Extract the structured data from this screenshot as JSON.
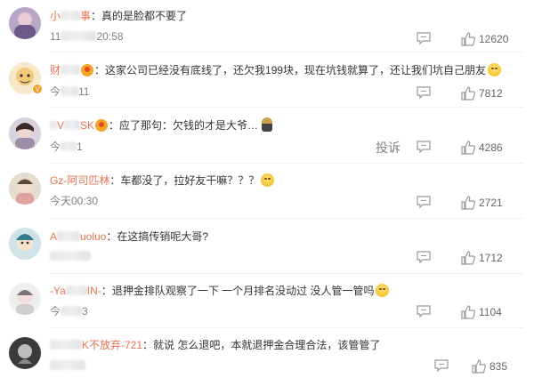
{
  "comments": [
    {
      "username_visible": "小",
      "username_tail": "事",
      "text": "真的是脸都不要了",
      "time_prefix": "11",
      "time_suffix": "20:58",
      "likes": "12620"
    },
    {
      "username_visible": "财",
      "username_tail": "",
      "text": "这家公司已经没有底线了，还欠我199块，现在坑钱就算了，还让我们坑自己朋友",
      "time_prefix": "今",
      "time_suffix": "11",
      "likes": "7812"
    },
    {
      "username_visible": "V",
      "username_tail": "SK",
      "text": "应了那句：欠钱的才是大爷…",
      "time_prefix": "今",
      "time_suffix": "1",
      "report_label": "投诉",
      "likes": "4286"
    },
    {
      "username_visible": "Gz-阿司匹林",
      "username_tail": "",
      "text": "车都没了，拉好友干嘛？？？",
      "time_prefix": "今天00:30",
      "time_suffix": "",
      "likes": "2721"
    },
    {
      "username_visible": "A",
      "username_tail": "uoluo",
      "text": "在这搞传销呢大哥?",
      "time_prefix": "",
      "time_suffix": "",
      "likes": "1712"
    },
    {
      "username_visible": "-Ya",
      "username_tail": "IN-",
      "text": "退押金排队观察了一下 一个月排名没动过 没人管一管吗",
      "time_prefix": "今",
      "time_suffix": "3",
      "likes": "1104"
    },
    {
      "username_visible": "",
      "username_tail": "K不放弃-721",
      "text": "就说 怎么退吧，本就退押金合理合法，该管管了",
      "time_prefix": "",
      "time_suffix": "",
      "likes": "835"
    }
  ],
  "icons": {
    "reply": "comment-reply-icon",
    "like": "thumbs-up-icon",
    "vip": "verified-badge-icon"
  },
  "colors": {
    "username": "#eb7350",
    "meta": "#808080"
  }
}
